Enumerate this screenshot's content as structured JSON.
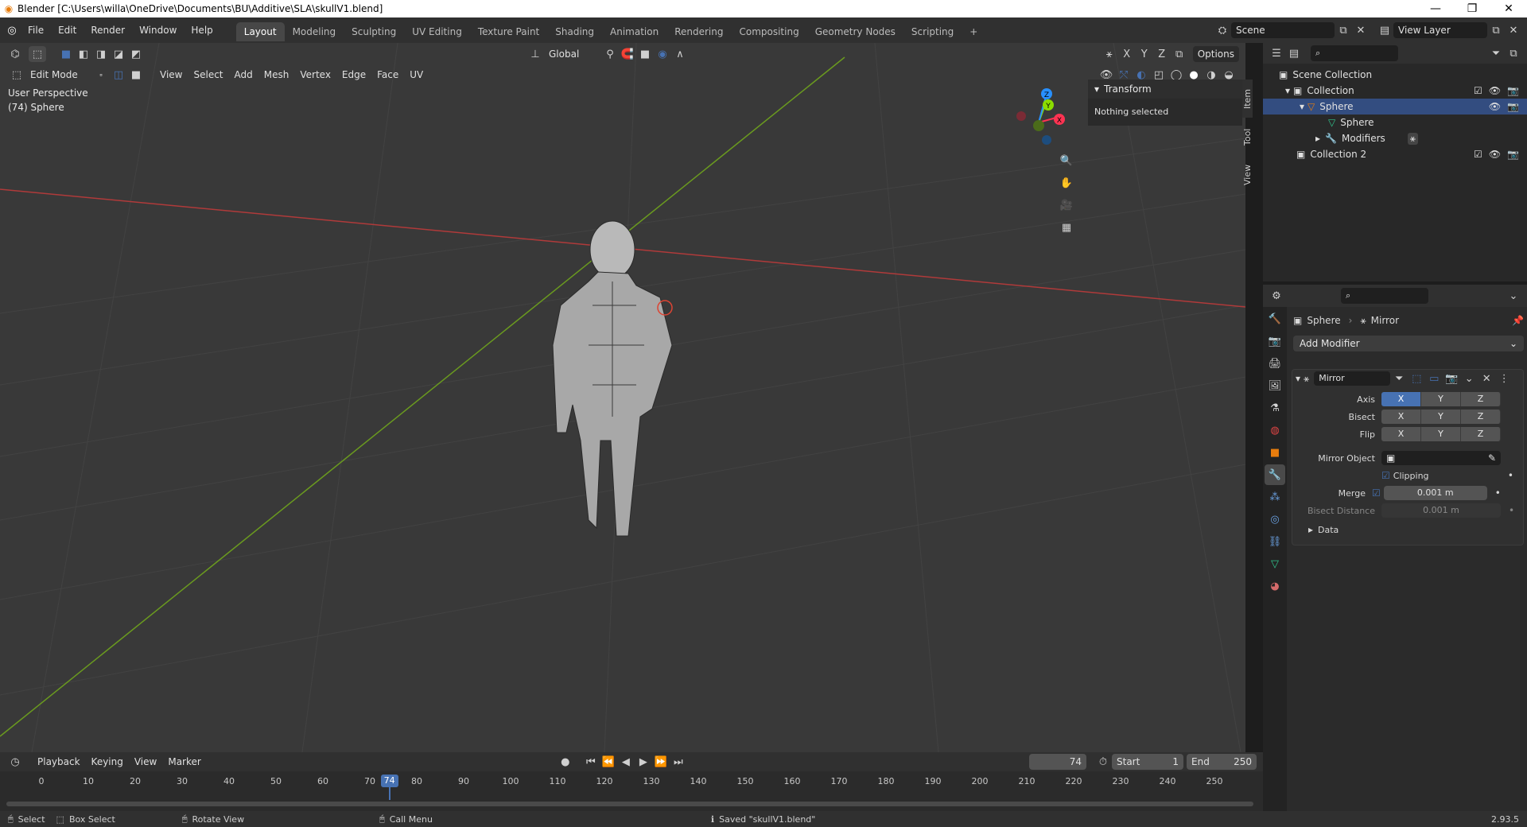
{
  "window": {
    "title": "Blender [C:\\Users\\willa\\OneDrive\\Documents\\BU\\Additive\\SLA\\skullV1.blend]"
  },
  "menu": [
    "File",
    "Edit",
    "Render",
    "Window",
    "Help"
  ],
  "workspaces": [
    "Layout",
    "Modeling",
    "Sculpting",
    "UV Editing",
    "Texture Paint",
    "Shading",
    "Animation",
    "Rendering",
    "Compositing",
    "Geometry Nodes",
    "Scripting"
  ],
  "active_workspace": "Layout",
  "scene": {
    "name": "Scene",
    "view_layer": "View Layer"
  },
  "viewport": {
    "mode": "Edit Mode",
    "menus": [
      "View",
      "Select",
      "Add",
      "Mesh",
      "Vertex",
      "Edge",
      "Face",
      "UV"
    ],
    "orientation": "Global",
    "options": "Options",
    "axes": [
      "X",
      "Y",
      "Z"
    ],
    "perspective": "User Perspective",
    "object_label": "(74) Sphere",
    "gizmo": {
      "x": "X",
      "y": "Y",
      "z": "Z"
    }
  },
  "npanel": {
    "header": "Transform",
    "body": "Nothing selected",
    "tabs": [
      "Item",
      "Tool",
      "View"
    ]
  },
  "outliner": {
    "rows": [
      {
        "label": "Scene Collection"
      },
      {
        "label": "Collection"
      },
      {
        "label": "Sphere"
      },
      {
        "label": "Sphere"
      },
      {
        "label": "Modifiers"
      },
      {
        "label": "Collection 2"
      }
    ]
  },
  "properties": {
    "object": "Sphere",
    "modifier_crumb": "Mirror",
    "add_modifier": "Add Modifier",
    "modifier": {
      "name": "Mirror",
      "axis_label": "Axis",
      "bisect_label": "Bisect",
      "flip_label": "Flip",
      "axes": [
        "X",
        "Y",
        "Z"
      ],
      "mirror_object_label": "Mirror Object",
      "clipping_label": "Clipping",
      "merge_label": "Merge",
      "merge_value": "0.001 m",
      "bisect_distance_label": "Bisect Distance",
      "bisect_distance_value": "0.001 m",
      "data_label": "Data"
    }
  },
  "timeline": {
    "menus": [
      "Playback",
      "Keying",
      "View",
      "Marker"
    ],
    "current_frame": "74",
    "start_label": "Start",
    "start": "1",
    "end_label": "End",
    "end": "250",
    "ticks": [
      "0",
      "10",
      "20",
      "30",
      "40",
      "50",
      "60",
      "70",
      "80",
      "90",
      "100",
      "110",
      "120",
      "130",
      "140",
      "150",
      "160",
      "170",
      "180",
      "190",
      "200",
      "210",
      "220",
      "230",
      "240",
      "250"
    ]
  },
  "status": {
    "select": "Select",
    "box_select": "Box Select",
    "rotate_view": "Rotate View",
    "call_menu": "Call Menu",
    "message": "Saved \"skullV1.blend\"",
    "version": "2.93.5"
  },
  "colors": {
    "accent": "#4772b3",
    "x_axis": "#ff3352",
    "y_axis": "#8bdc00",
    "z_axis": "#2890ff",
    "orange": "#e87d0d"
  }
}
